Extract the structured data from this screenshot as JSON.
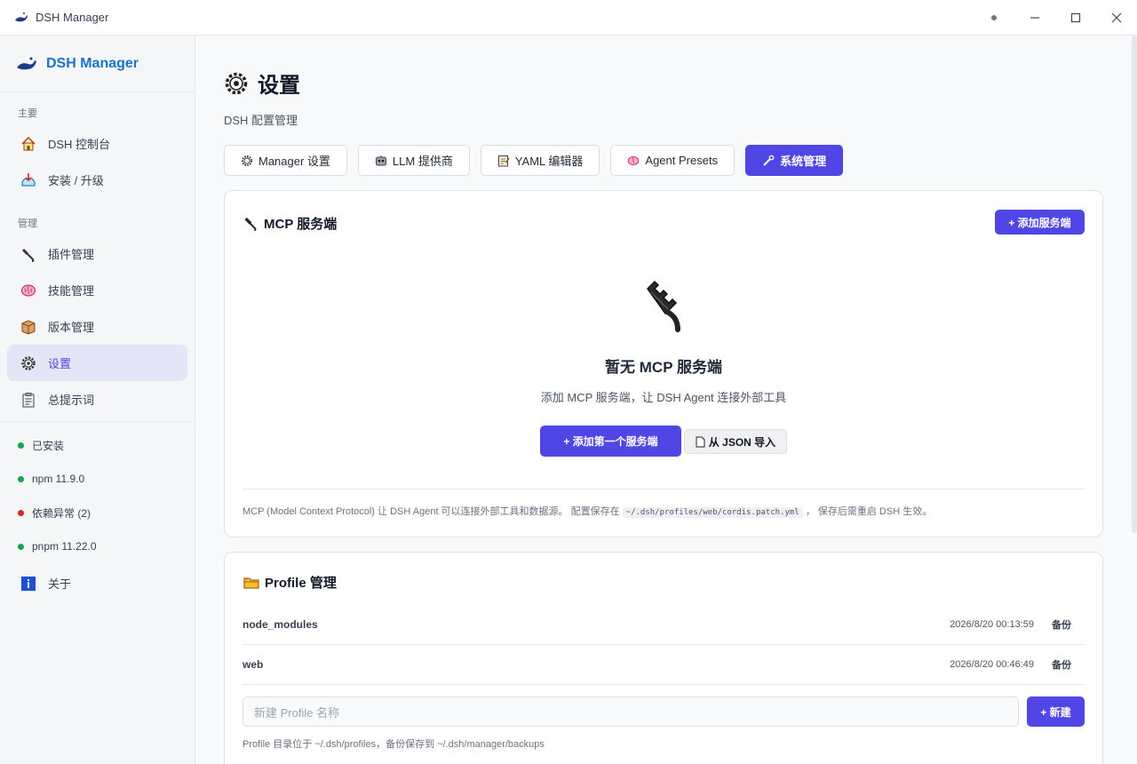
{
  "window": {
    "title": "DSH Manager"
  },
  "sidebar": {
    "brand": "DSH Manager",
    "sections": [
      {
        "label": "主要",
        "items": [
          "DSH 控制台",
          "安装 / 升级"
        ]
      },
      {
        "label": "管理",
        "items": [
          "插件管理",
          "技能管理",
          "版本管理",
          "设置",
          "总提示词"
        ]
      }
    ],
    "active": "设置",
    "status": [
      {
        "label": "已安装",
        "color": "#16a34a"
      },
      {
        "label": "npm 11.9.0",
        "color": "#16a34a"
      },
      {
        "label": "依赖异常 (2)",
        "color": "#dc2626"
      },
      {
        "label": "pnpm 11.22.0",
        "color": "#16a34a"
      }
    ],
    "about": "关于"
  },
  "page": {
    "title": "设置",
    "subtitle": "DSH 配置管理"
  },
  "tabs": [
    {
      "label": "Manager 设置",
      "icon": "gear-icon"
    },
    {
      "label": "LLM 提供商",
      "icon": "robot-icon"
    },
    {
      "label": "YAML 编辑器",
      "icon": "memo-icon"
    },
    {
      "label": "Agent Presets",
      "icon": "brain-icon"
    },
    {
      "label": "系统管理",
      "icon": "wrench-icon",
      "active": true
    }
  ],
  "mcp": {
    "title": "MCP 服务端",
    "add_button": "+ 添加服务端",
    "empty_title": "暂无 MCP 服务端",
    "empty_desc": "添加 MCP 服务端，让 DSH Agent 连接外部工具",
    "add_first_button": "+ 添加第一个服务端",
    "import_button": "从 JSON 导入",
    "note_before": "MCP (Model Context Protocol) 让 DSH Agent 可以连接外部工具和数据源。 配置保存在",
    "note_path": "~/.dsh/profiles/web/cordis.patch.yml",
    "note_after": "， 保存后需重启 DSH 生效。"
  },
  "profile": {
    "title": "Profile 管理",
    "rows": [
      {
        "name": "node_modules",
        "time": "2026/8/20 00:13:59",
        "action": "备份"
      },
      {
        "name": "web",
        "time": "2026/8/20 00:46:49",
        "action": "备份"
      }
    ],
    "input_placeholder": "新建 Profile 名称",
    "new_button": "+ 新建",
    "hint": "Profile 目录位于 ~/.dsh/profiles，备份保存到 ~/.dsh/manager/backups"
  },
  "colors": {
    "accent": "#4f46e5",
    "brand": "#1a73c8"
  }
}
